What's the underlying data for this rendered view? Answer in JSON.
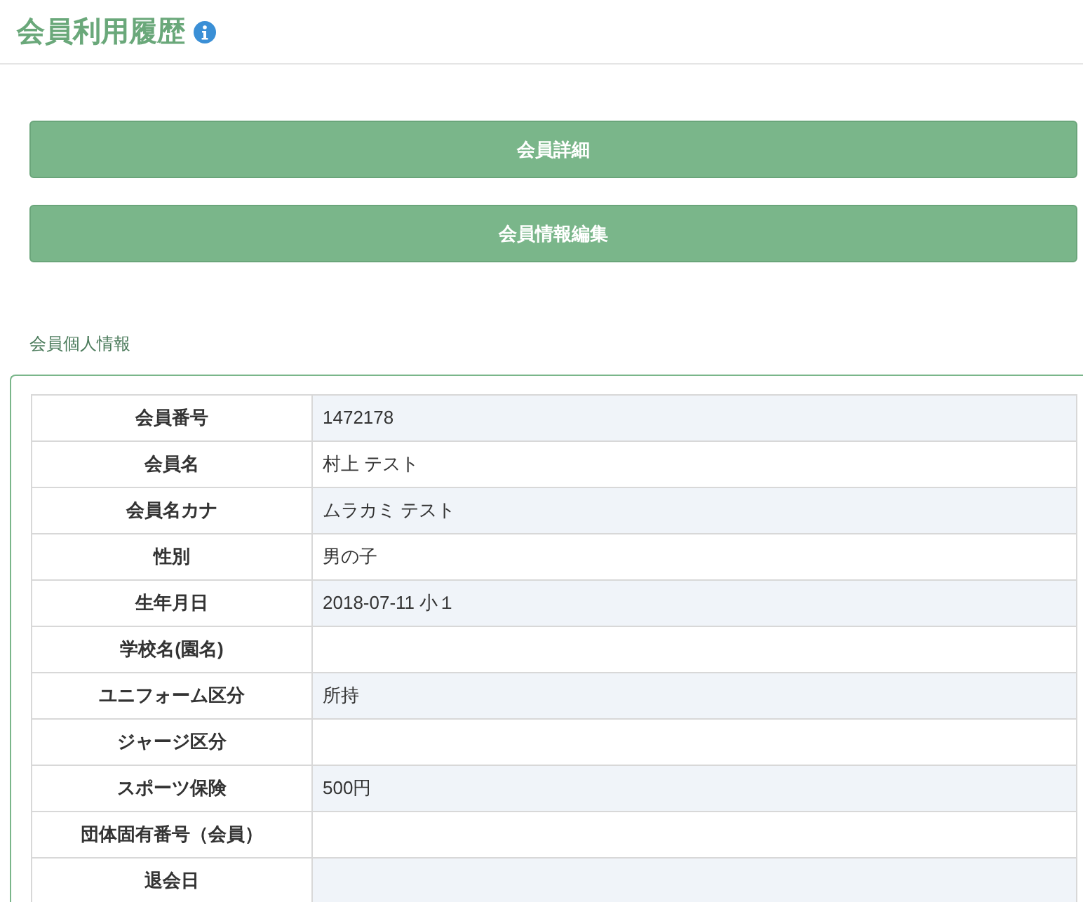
{
  "page_title": "会員利用履歴",
  "buttons": [
    "会員詳細",
    "会員情報編集"
  ],
  "section": {
    "title": "会員個人情報",
    "rows": [
      {
        "label": "会員番号",
        "value": "1472178"
      },
      {
        "label": "会員名",
        "value": "村上 テスト"
      },
      {
        "label": "会員名カナ",
        "value": "ムラカミ テスト"
      },
      {
        "label": "性別",
        "value": "男の子"
      },
      {
        "label": "生年月日",
        "value": "2018-07-11  小１"
      },
      {
        "label": "学校名(園名)"
      },
      {
        "label": "ユニフォーム区分",
        "value": "所持"
      },
      {
        "label": "ジャージ区分"
      },
      {
        "label": "スポーツ保険",
        "value": "500円"
      },
      {
        "label": "団体固有番号（会員）"
      },
      {
        "label": "退会日"
      }
    ]
  }
}
